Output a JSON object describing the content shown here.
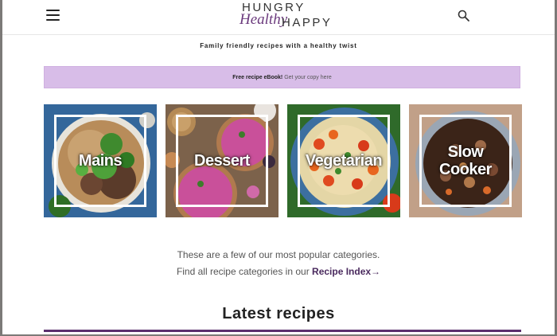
{
  "header": {
    "menu_icon": "hamburger-menu-icon",
    "logo": {
      "top": "HUNGRY",
      "script": "Healthy",
      "right": "HAPPY"
    },
    "search_icon": "search-icon"
  },
  "tagline": "Family friendly recipes with a healthy twist",
  "banner": {
    "bold": "Free recipe eBook!",
    "link": "Get your copy here",
    "background": "#d8bde8"
  },
  "categories": [
    {
      "label": "Mains"
    },
    {
      "label": "Dessert"
    },
    {
      "label": "Vegetarian"
    },
    {
      "label_line1": "Slow",
      "label_line2": "Cooker"
    }
  ],
  "intro": {
    "line1": "These are a few of our most popular categories.",
    "line2_prefix": "Find all recipe categories in our ",
    "line2_link": "Recipe Index→"
  },
  "latest_heading": "Latest recipes",
  "colors": {
    "accent": "#5a2f6e",
    "link": "#4a2a5e"
  }
}
